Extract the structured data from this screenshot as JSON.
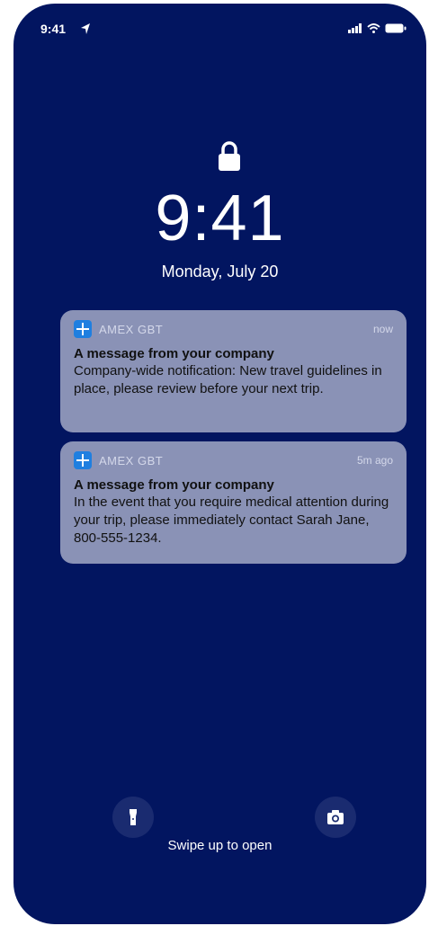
{
  "status_bar": {
    "time": "9:41"
  },
  "lock_screen": {
    "time": "9:41",
    "date": "Monday, July 20"
  },
  "notifications": [
    {
      "app": "AMEX GBT",
      "time": "now",
      "title": "A message from your company",
      "body": "Company-wide notification: New travel guidelines in place, please review before your next trip."
    },
    {
      "app": "AMEX GBT",
      "time": "5m ago",
      "title": "A message from your company",
      "body": "In the event that you require medical attention during your trip, please immediately contact Sarah Jane, 800-555-1234."
    }
  ],
  "bottom": {
    "swipe_text": "Swipe up to open"
  },
  "colors": {
    "background": "#021560",
    "notification": "#8a92b6",
    "app_icon": "#1f7fe0"
  }
}
